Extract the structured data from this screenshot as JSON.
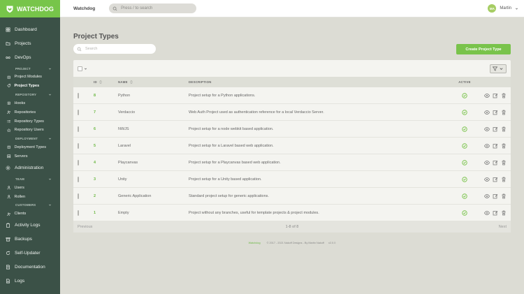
{
  "brand": {
    "name": "WATCHDOG"
  },
  "topbar": {
    "title": "Watchdog",
    "search_placeholder": "Press / to search",
    "user_initials": "MA",
    "user_name": "Martin"
  },
  "sidebar": {
    "dashboard": "Dashboard",
    "projects": "Projects",
    "devops": "DevOps",
    "project_section": "PROJECT",
    "project_modules": "Project Modules",
    "project_types": "Project Types",
    "repository_section": "REPOSITORY",
    "hooks": "Hooks",
    "repositories": "Repositories",
    "repository_types": "Repository Types",
    "repository_users": "Repository Users",
    "deployment_section": "DEPLOYMENT",
    "deployment_types": "Deployment Types",
    "servers": "Servers",
    "administration": "Administration",
    "team_section": "TEAM",
    "users": "Users",
    "rollen": "Rollen",
    "customers_section": "CUSTOMERS",
    "clients": "Clients",
    "activity_logs": "Activity Logs",
    "backups": "Backups",
    "self_updater": "Self-Updater",
    "documentation": "Documentation",
    "logs": "Logs"
  },
  "page": {
    "title": "Project Types",
    "search_placeholder": "Search",
    "create_label": "Create Project Type"
  },
  "table": {
    "headers": {
      "id": "ID",
      "name": "NAME",
      "description": "DESCRIPTION",
      "active": "ACTIVE"
    },
    "rows": [
      {
        "id": "8",
        "name": "Python",
        "description": "Project setup for a Python applications.",
        "active": true
      },
      {
        "id": "7",
        "name": "Verdaccio",
        "description": "Web Auth Project used as authentication reference for a local Verdaccio Server.",
        "active": true
      },
      {
        "id": "6",
        "name": "NWJS",
        "description": "Project setup for a node webkit based application.",
        "active": true
      },
      {
        "id": "5",
        "name": "Laravel",
        "description": "Project setup for a Laravel based web application.",
        "active": true
      },
      {
        "id": "4",
        "name": "Playcanvas",
        "description": "Project setup for a Playcanvas based web application.",
        "active": true
      },
      {
        "id": "3",
        "name": "Unity",
        "description": "Project setup for a Unity based application.",
        "active": true
      },
      {
        "id": "2",
        "name": "Generic Application",
        "description": "Standard project setup for generic applications.",
        "active": true
      },
      {
        "id": "1",
        "name": "Empty",
        "description": "Project without any branches, useful for template projects & project modules.",
        "active": true
      }
    ],
    "pagination": {
      "prev": "Previous",
      "info": "1-8 of 8",
      "next": "Next"
    }
  },
  "footer": {
    "link": "Watchdog",
    "copyright": "© 2017 - 2021 Nakoff Designs - By Martin Nakoff",
    "version": "v2.0.0"
  },
  "colors": {
    "accent": "#79c34b",
    "sidebar": "#3b5147",
    "background": "#dcdcd4"
  }
}
